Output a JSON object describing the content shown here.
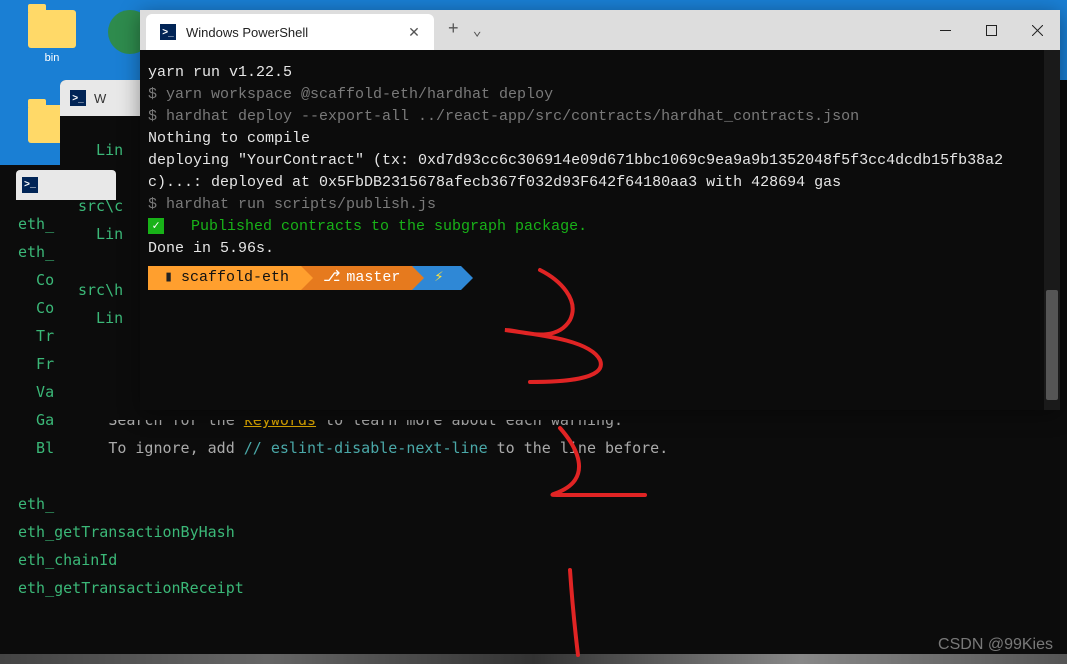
{
  "desktop": {
    "icon1_label": "bin"
  },
  "main_window": {
    "tab_title": "Windows PowerShell",
    "lines": {
      "l1": "yarn run v1.22.5",
      "l2": "$ yarn workspace @scaffold-eth/hardhat deploy",
      "l3": "$ hardhat deploy --export-all ../react-app/src/contracts/hardhat_contracts.json",
      "l4": "Nothing to compile",
      "l5": "deploying \"YourContract\" (tx: 0xd7d93cc6c306914e09d671bbc1069c9ea9a9b1352048f5f3cc4dcdb15fb38a2c)...: deployed at 0x5FbDB2315678afecb367f032d93F642f64180aa3 with 428694 gas",
      "l6": "$ hardhat run scripts/publish.js",
      "l7": "   Published contracts to the subgraph package.",
      "l8": "Done in 5.96s."
    },
    "prompt": {
      "dir": "scaffold-eth",
      "branch": "master"
    }
  },
  "bg_window2": {
    "tab_title": "W",
    "lines": {
      "l1": "  Lin",
      "l2": "",
      "l3": "src\\c",
      "l4": "  Lin",
      "l5": "",
      "l6": "src\\h",
      "l7": "  Lin"
    }
  },
  "bg_window1": {
    "lines": {
      "l1": "eth_",
      "l2": "eth_",
      "l3": "  Co",
      "l4": "  Co",
      "l5": "  Tr",
      "l6": "  Fr",
      "l7": "  Va",
      "l8": "  Ga",
      "l9": "  Bl",
      "s1": "Search for the ",
      "s2": "keywords",
      "s3": " to learn more about each warning.",
      "i1": "To ignore, add ",
      "i2": "// eslint-disable-next-line",
      "i3": " to the line before.",
      "e1": "eth_",
      "e2": "eth_getTransactionByHash",
      "e3": "eth_chainId",
      "e4": "eth_getTransactionReceipt"
    }
  },
  "watermark": "CSDN @99Kies"
}
